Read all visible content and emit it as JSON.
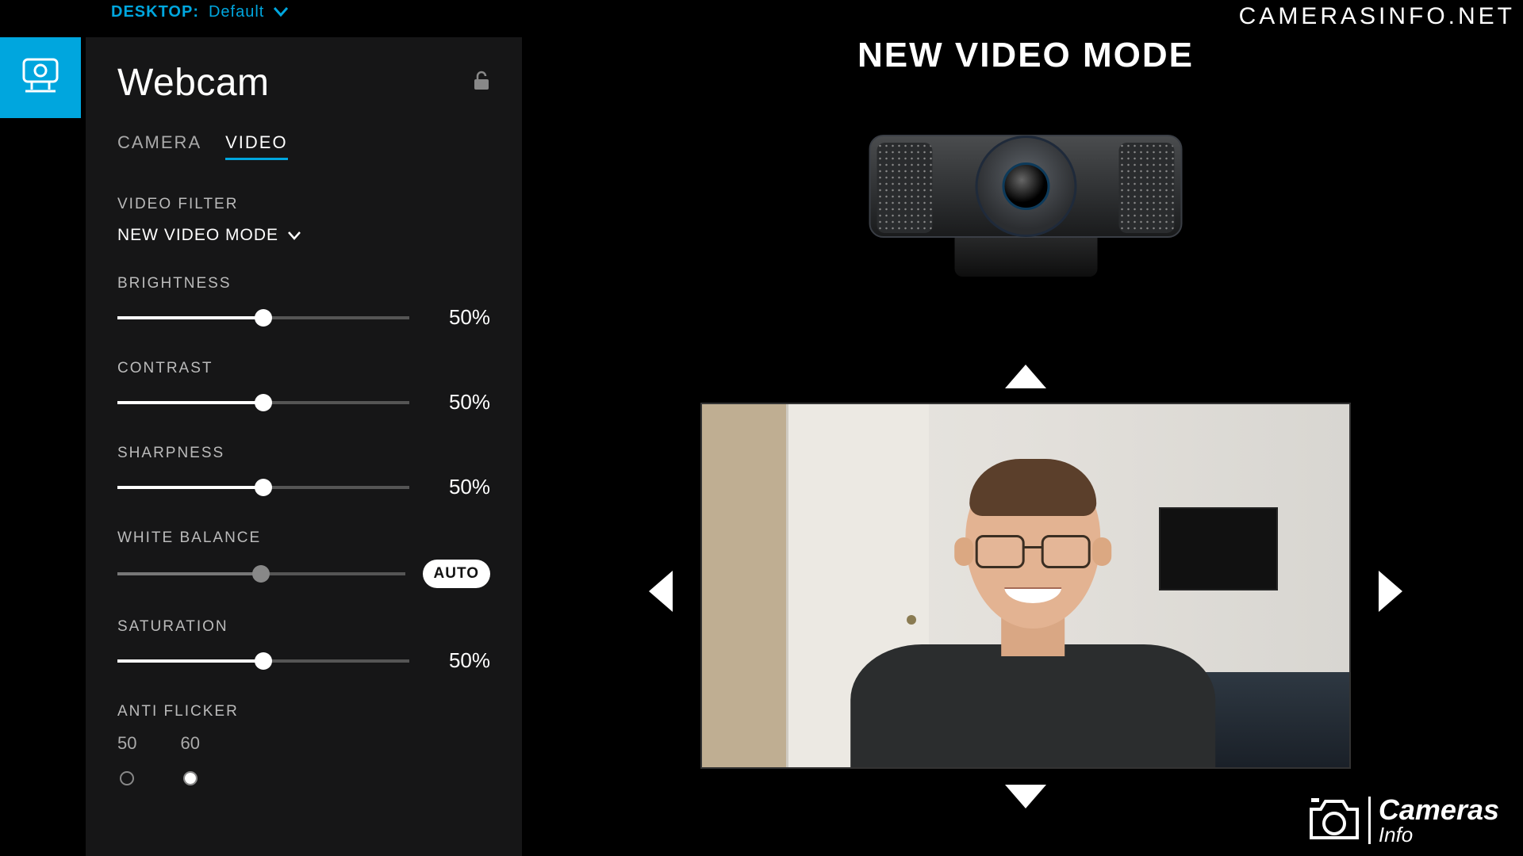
{
  "top": {
    "desktop_label": "DESKTOP:",
    "desktop_value": "Default"
  },
  "panel": {
    "title": "Webcam",
    "tabs": {
      "camera": "CAMERA",
      "video": "VIDEO",
      "active": "video"
    },
    "filter": {
      "label": "VIDEO FILTER",
      "value": "NEW VIDEO MODE"
    },
    "sliders": {
      "brightness": {
        "label": "BRIGHTNESS",
        "percent": 50,
        "display": "50%"
      },
      "contrast": {
        "label": "CONTRAST",
        "percent": 50,
        "display": "50%"
      },
      "sharpness": {
        "label": "SHARPNESS",
        "percent": 50,
        "display": "50%"
      },
      "white_balance": {
        "label": "WHITE BALANCE",
        "percent": 50,
        "auto_label": "AUTO",
        "auto": true
      },
      "saturation": {
        "label": "SATURATION",
        "percent": 50,
        "display": "50%"
      }
    },
    "anti_flicker": {
      "label": "ANTI FLICKER",
      "options": [
        "50",
        "60"
      ],
      "selected": "60"
    }
  },
  "main": {
    "mode_title": "NEW VIDEO MODE"
  },
  "watermark": {
    "top_text": "CAMERASINFO.NET",
    "logo_line1": "Cameras",
    "logo_line2": "Info"
  }
}
